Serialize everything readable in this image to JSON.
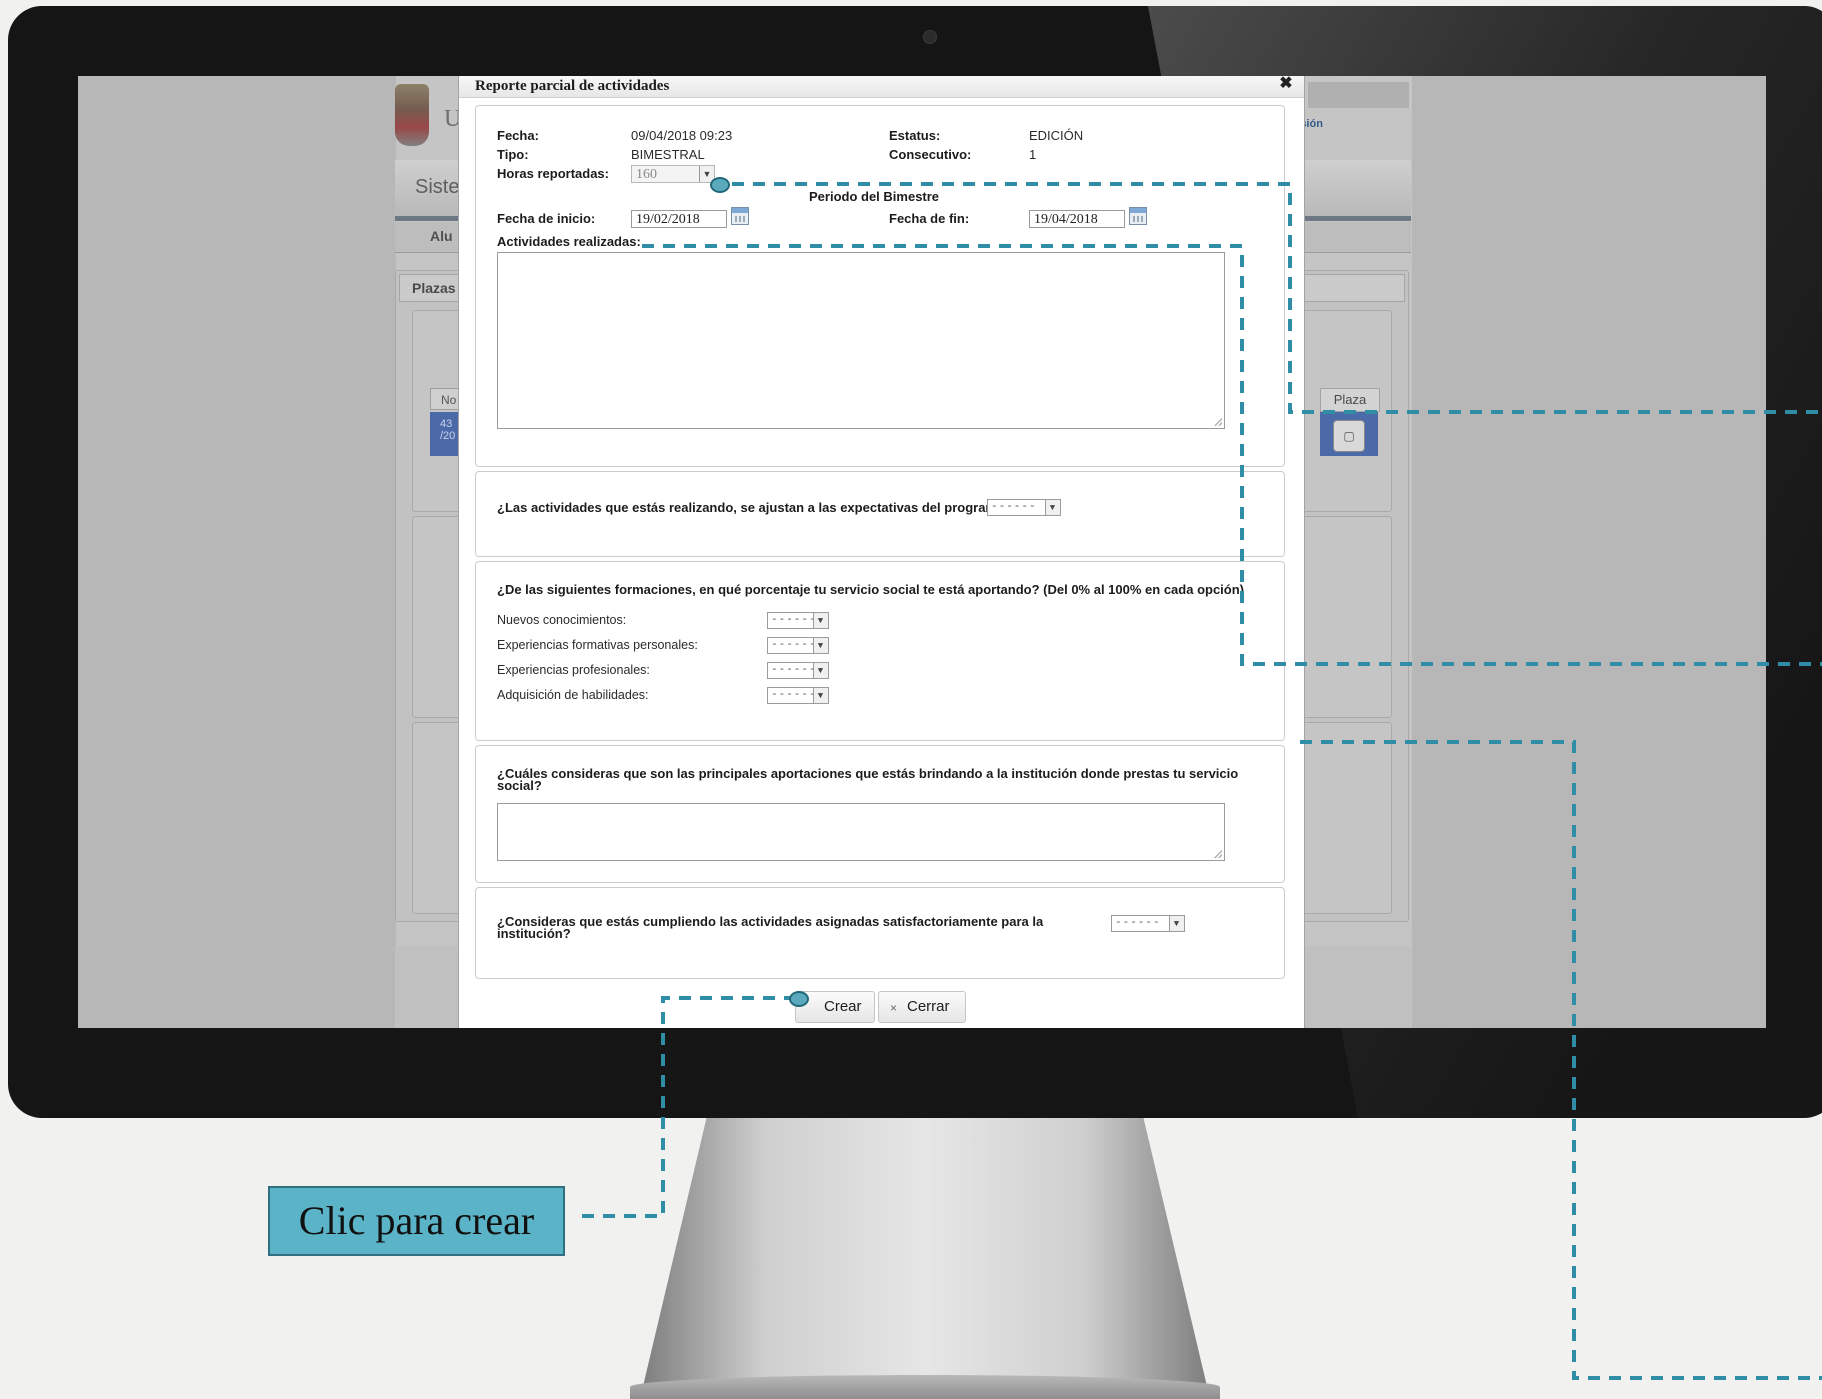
{
  "background": {
    "university_initial": "U",
    "logout_link": "Cerrar sesión",
    "system_title_partial": "Siste",
    "tab_partial": "Alu",
    "panel_title_partial": "Plazas",
    "table_header_partial": "No",
    "table_row_partial_line1": "43",
    "table_row_partial_line2": "/20",
    "plaza_header": "Plaza"
  },
  "modal": {
    "title": "Reporte parcial de actividades",
    "close_symbol": "✖",
    "fields": {
      "fecha_label": "Fecha:",
      "fecha_value": "09/04/2018 09:23",
      "estatus_label": "Estatus:",
      "estatus_value": "EDICIÓN",
      "tipo_label": "Tipo:",
      "tipo_value": "BIMESTRAL",
      "consecutivo_label": "Consecutivo:",
      "consecutivo_value": "1",
      "horas_label": "Horas reportadas:",
      "horas_value": "160",
      "periodo_heading": "Periodo del Bimestre",
      "fecha_inicio_label": "Fecha de inicio:",
      "fecha_inicio_value": "19/02/2018",
      "fecha_fin_label": "Fecha de fin:",
      "fecha_fin_value": "19/04/2018",
      "actividades_label": "Actividades realizadas:"
    },
    "question_expectativas": "¿Las actividades que estás realizando, se ajustan a las expectativas del programa?",
    "question_formaciones": "¿De las siguientes formaciones, en qué porcentaje tu servicio social te está aportando? (Del 0% al 100% en cada opción)",
    "formaciones_options": [
      {
        "label": "Nuevos conocimientos:",
        "selected": "------"
      },
      {
        "label": "Experiencias formativas personales:",
        "selected": "------"
      },
      {
        "label": "Experiencias profesionales:",
        "selected": "------"
      },
      {
        "label": "Adquisición de habilidades:",
        "selected": "------"
      }
    ],
    "question_aportaciones": "¿Cuáles consideras que son las principales aportaciones que estás brindando a la institución donde prestas tu servicio social?",
    "question_cumpliendo": "¿Consideras que estás cumpliendo las actividades asignadas satisfactoriamente para la institución?",
    "dropdown_placeholder": "------",
    "buttons": {
      "crear": "Crear",
      "cerrar": "Cerrar",
      "cerrar_icon": "×"
    }
  },
  "annotation": {
    "label": "Clic para crear",
    "color": "#5ab3c7"
  }
}
